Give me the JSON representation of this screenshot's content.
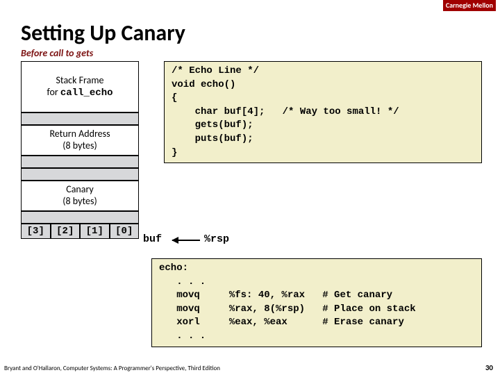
{
  "brand": "Carnegie Mellon",
  "title": "Setting Up Canary",
  "subtitle": "Before call to gets",
  "stack": {
    "frame_label_l1": "Stack Frame",
    "frame_label_l2_pre": "for ",
    "frame_label_l2_mono": "call_echo",
    "return_l1": "Return Address",
    "return_l2": "(8 bytes)",
    "canary_l1": "Canary",
    "canary_l2": "(8 bytes)",
    "idx": [
      "[3]",
      "[2]",
      "[1]",
      "[0]"
    ]
  },
  "buf_label": "buf",
  "rsp_label": "%rsp",
  "c_code": "/* Echo Line */\nvoid echo()\n{\n    char buf[4];   /* Way too small! */\n    gets(buf);\n    puts(buf);\n}",
  "asm_code": "echo:\n   . . .\n   movq     %fs: 40, %rax   # Get canary\n   movq     %rax, 8(%rsp)   # Place on stack\n   xorl     %eax, %eax      # Erase canary\n   . . .",
  "footer": "Bryant and O'Hallaron, Computer Systems: A Programmer's Perspective, Third Edition",
  "page": "30"
}
